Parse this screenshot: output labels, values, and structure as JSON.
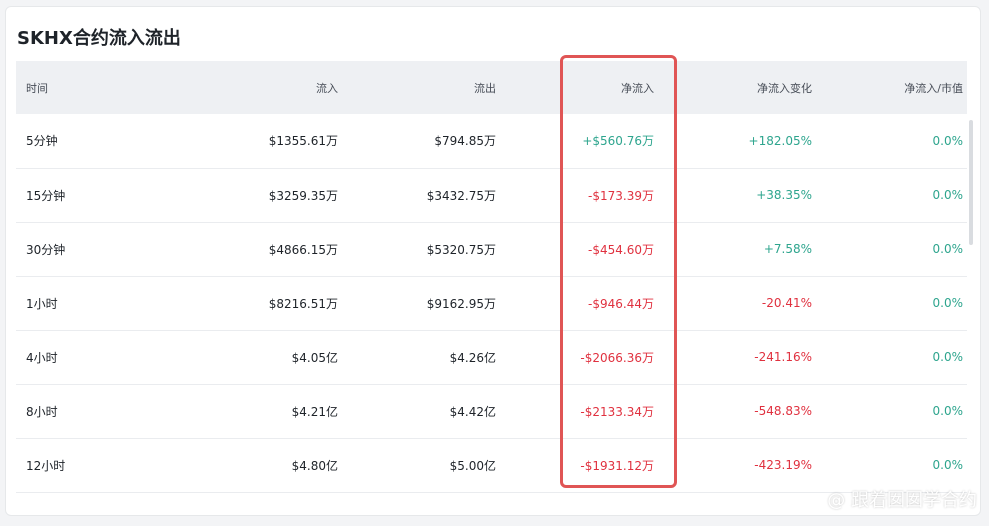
{
  "title": "SKHX合约流入流出",
  "headers": [
    "时间",
    "流入",
    "流出",
    "净流入",
    "净流入变化",
    "净流入/市值"
  ],
  "rows": [
    {
      "time": "5分钟",
      "inflow": "$1355.61万",
      "outflow": "$794.85万",
      "net": "+$560.76万",
      "net_dir": "pos",
      "change": "+182.05%",
      "change_dir": "pos",
      "ratio": "0.0%"
    },
    {
      "time": "15分钟",
      "inflow": "$3259.35万",
      "outflow": "$3432.75万",
      "net": "-$173.39万",
      "net_dir": "neg",
      "change": "+38.35%",
      "change_dir": "pos",
      "ratio": "0.0%"
    },
    {
      "time": "30分钟",
      "inflow": "$4866.15万",
      "outflow": "$5320.75万",
      "net": "-$454.60万",
      "net_dir": "neg",
      "change": "+7.58%",
      "change_dir": "pos",
      "ratio": "0.0%"
    },
    {
      "time": "1小时",
      "inflow": "$8216.51万",
      "outflow": "$9162.95万",
      "net": "-$946.44万",
      "net_dir": "neg",
      "change": "-20.41%",
      "change_dir": "neg",
      "ratio": "0.0%"
    },
    {
      "time": "4小时",
      "inflow": "$4.05亿",
      "outflow": "$4.26亿",
      "net": "-$2066.36万",
      "net_dir": "neg",
      "change": "-241.16%",
      "change_dir": "neg",
      "ratio": "0.0%"
    },
    {
      "time": "8小时",
      "inflow": "$4.21亿",
      "outflow": "$4.42亿",
      "net": "-$2133.34万",
      "net_dir": "neg",
      "change": "-548.83%",
      "change_dir": "neg",
      "ratio": "0.0%"
    },
    {
      "time": "12小时",
      "inflow": "$4.80亿",
      "outflow": "$5.00亿",
      "net": "-$1931.12万",
      "net_dir": "neg",
      "change": "-423.19%",
      "change_dir": "neg",
      "ratio": "0.0%"
    }
  ],
  "watermark": "@ 跟着囡囡学合约",
  "colors": {
    "positive": "#2ea58e",
    "negative": "#e0313f",
    "highlight": "#e05555"
  },
  "icons": {
    "watermark_logo": "wechat-channels-icon"
  }
}
